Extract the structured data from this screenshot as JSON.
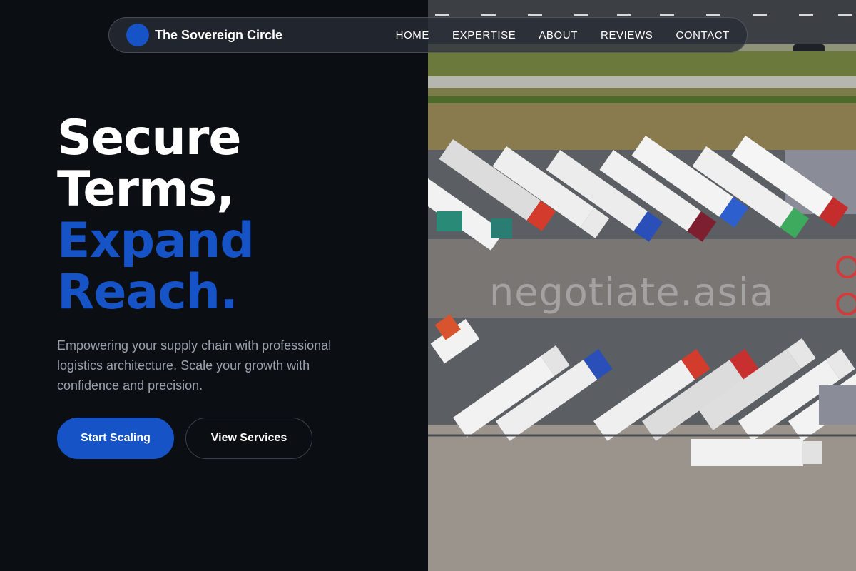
{
  "brand": {
    "name": "The Sovereign Circle",
    "logo_icon": "circle-logo-icon"
  },
  "nav": {
    "items": [
      "HOME",
      "EXPERTISE",
      "ABOUT",
      "REVIEWS",
      "CONTACT"
    ]
  },
  "hero": {
    "title_line1": "Secure",
    "title_line2": "Terms,",
    "title_line3": "Expand",
    "title_line4": "Reach.",
    "subtitle": "Empowering your supply chain with professional logistics architecture. Scale your growth with confidence and precision.",
    "primary_button": "Start Scaling",
    "secondary_button": "View Services"
  },
  "image": {
    "watermark": "negotiate.asia"
  },
  "colors": {
    "accent": "#1553c6",
    "background": "#0b0e13",
    "muted_text": "#9ba2ad"
  }
}
